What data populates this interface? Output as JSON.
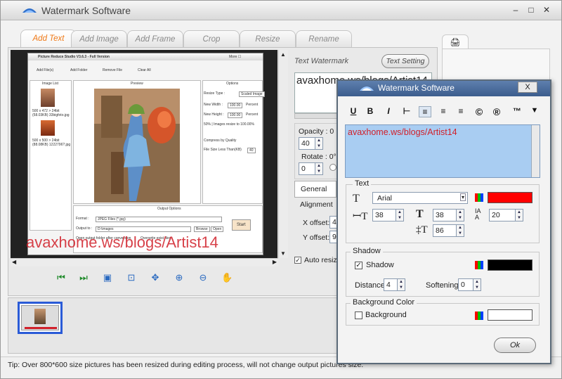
{
  "app": {
    "title": "Watermark Software"
  },
  "window_controls": {
    "minimize": "–",
    "maximize": "□",
    "close": "✕"
  },
  "tabs": [
    {
      "label": "Add Text"
    },
    {
      "label": "Add Image"
    },
    {
      "label": "Add Frame"
    },
    {
      "label": "Crop"
    },
    {
      "label": "Resize"
    },
    {
      "label": "Rename"
    }
  ],
  "inner_app": {
    "title": "Picture Reduce Studio V3.6.3 - Full Version",
    "menu": "More ☐",
    "toolbar": [
      "Add File(s)",
      "Add Folder",
      "Remove File",
      "Clear All"
    ],
    "image_list_header": "Image List",
    "preview_header": "Preview",
    "options_header": "Options",
    "list_items": [
      {
        "caption": "500 x 472 > 24bit\n(58.03KB) 33bigfoto.jpg"
      },
      {
        "caption": "500 x 500 > 24bit\n(88.08KB) 1222796?.jpg"
      }
    ],
    "options": {
      "resize_type_label": "Resize Type :",
      "resize_type_value": "Scaled Image",
      "new_width_label": "New Width :",
      "new_width_value": "100.00",
      "new_width_unit": "Percent",
      "new_height_label": "New Height :",
      "new_height_value": "100.00",
      "new_height_unit": "Percent",
      "info": "50% | Images resize to 100.00%",
      "compress_label": "Compress by Quality",
      "file_size_label": "File Size Less Than(KB)",
      "file_size_value": "40"
    },
    "output": {
      "header": "Output Options",
      "format_label": "Format :",
      "format_value": "JPEG Files (*.jpg)",
      "output_to_label": "Output to :",
      "output_to_value": "D:\\images",
      "browse": "Browse",
      "open": "Open",
      "start": "Start",
      "open_folder_check": "Open output folder after conversion",
      "overwrite_check": "Overwrite exist files"
    }
  },
  "preview_watermark": "avaxhome.ws/blogs/Artist14",
  "right_panel": {
    "text_watermark_label": "Text Watermark",
    "text_setting_button": "Text Setting",
    "text_value": "avaxhome.ws/blogs/Artist14",
    "opacity_label": "Opacity : 0",
    "opacity_value": "40",
    "rotate_label": "Rotate : 0°",
    "rotate_value": "0",
    "general_tab": "General",
    "alignment_label": "Alignment",
    "x_offset_label": "X offset:",
    "x_offset_value": "4",
    "y_offset_label": "Y offset:",
    "y_offset_value": "9",
    "auto_resize_label": "Auto resize"
  },
  "status": {
    "tip": "Tip: Over 800*600 size pictures has been resized during editing process, will not change output pictures size."
  },
  "dialog": {
    "title": "Watermark Software",
    "close": "X",
    "format_buttons": [
      {
        "name": "underline",
        "glyph": "U"
      },
      {
        "name": "bold",
        "glyph": "B"
      },
      {
        "name": "italic",
        "glyph": "I"
      },
      {
        "name": "strikethrough",
        "glyph": "⊢"
      },
      {
        "name": "align-left",
        "glyph": "≡"
      },
      {
        "name": "align-center",
        "glyph": "≡"
      },
      {
        "name": "align-right",
        "glyph": "≡"
      },
      {
        "name": "copyright",
        "glyph": "©"
      },
      {
        "name": "registered",
        "glyph": "®"
      },
      {
        "name": "trademark",
        "glyph": "™"
      },
      {
        "name": "more",
        "glyph": "▼"
      }
    ],
    "watermark_text": "avaxhome.ws/blogs/Artist14",
    "text_group": {
      "title": "Text",
      "font": "Arial",
      "font_color": "#ff0000",
      "size_value": "38",
      "height_value": "38",
      "spacing_value": "20",
      "weight_value": "86"
    },
    "shadow_group": {
      "title": "Shadow",
      "checkbox_label": "Shadow",
      "checked": true,
      "shadow_color": "#000000",
      "distance_label": "Distance:",
      "distance_value": "4",
      "softening_label": "Softening:",
      "softening_value": "0"
    },
    "background_group": {
      "title": "Background Color",
      "checkbox_label": "Background",
      "checked": false,
      "bg_color": "#ffffff"
    },
    "ok_button": "Ok"
  }
}
